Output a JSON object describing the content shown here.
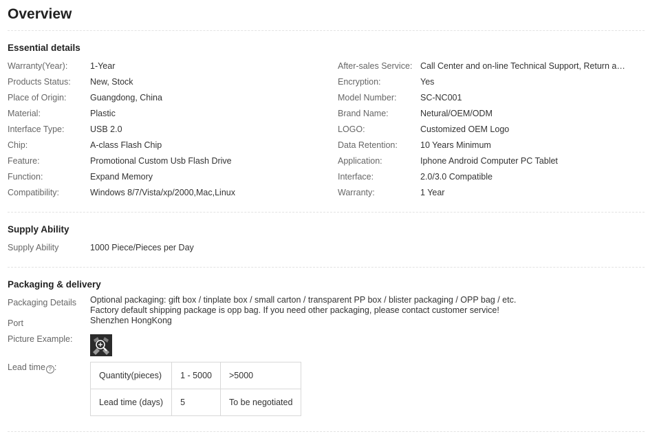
{
  "title": "Overview",
  "essential": {
    "heading": "Essential details",
    "left": [
      {
        "label": "Warranty(Year):",
        "value": "1-Year"
      },
      {
        "label": "Products Status:",
        "value": "New, Stock"
      },
      {
        "label": "Place of Origin:",
        "value": "Guangdong, China"
      },
      {
        "label": "Material:",
        "value": "Plastic"
      },
      {
        "label": "Interface Type:",
        "value": "USB 2.0"
      },
      {
        "label": "Chip:",
        "value": "A-class Flash Chip"
      },
      {
        "label": "Feature:",
        "value": "Promotional Custom Usb Flash Drive"
      },
      {
        "label": "Function:",
        "value": "Expand Memory"
      },
      {
        "label": "Compatibility:",
        "value": "Windows 8/7/Vista/xp/2000,Mac,Linux"
      }
    ],
    "right": [
      {
        "label": "After-sales Service:",
        "value": "Call Center and on-line Technical Support, Return and ..."
      },
      {
        "label": "Encryption:",
        "value": "Yes"
      },
      {
        "label": "Model Number:",
        "value": "SC-NC001"
      },
      {
        "label": "Brand Name:",
        "value": "Netural/OEM/ODM"
      },
      {
        "label": "LOGO:",
        "value": "Customized OEM Logo"
      },
      {
        "label": "Data Retention:",
        "value": "10 Years Minimum"
      },
      {
        "label": "Application:",
        "value": "Iphone Android Computer PC Tablet"
      },
      {
        "label": "Interface:",
        "value": "2.0/3.0 Compatible"
      },
      {
        "label": "Warranty:",
        "value": "1 Year"
      }
    ]
  },
  "supply": {
    "heading": "Supply Ability",
    "label": "Supply Ability",
    "value": "1000 Piece/Pieces per Day"
  },
  "packaging": {
    "heading": "Packaging & delivery",
    "details_label": "Packaging Details",
    "details_line1": "Optional packaging: gift box / tinplate box / small carton / transparent PP box / blister packaging / OPP bag / etc.",
    "details_line2": "Factory default shipping package is opp bag. If you need other packaging, please contact customer service!",
    "port_label": "Port",
    "port_value": "Shenzhen HongKong",
    "picture_label": "Picture Example:",
    "lead_label": "Lead time",
    "lead_help": "?",
    "lead_suffix": ":",
    "lead_table": {
      "row1": [
        "Quantity(pieces)",
        "1 - 5000",
        ">5000"
      ],
      "row2": [
        "Lead time (days)",
        "5",
        "To be negotiated"
      ]
    }
  }
}
